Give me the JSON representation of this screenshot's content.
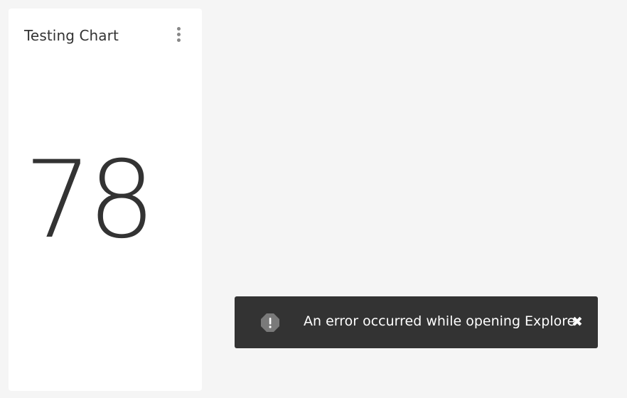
{
  "chart_card": {
    "title": "Testing Chart",
    "value": "78",
    "menu_icon": "more-vertical-icon"
  },
  "toast": {
    "message": "An error occurred while opening Explore",
    "icon": "warning-octagon-icon",
    "close_glyph": "✖",
    "background": "#333333"
  }
}
